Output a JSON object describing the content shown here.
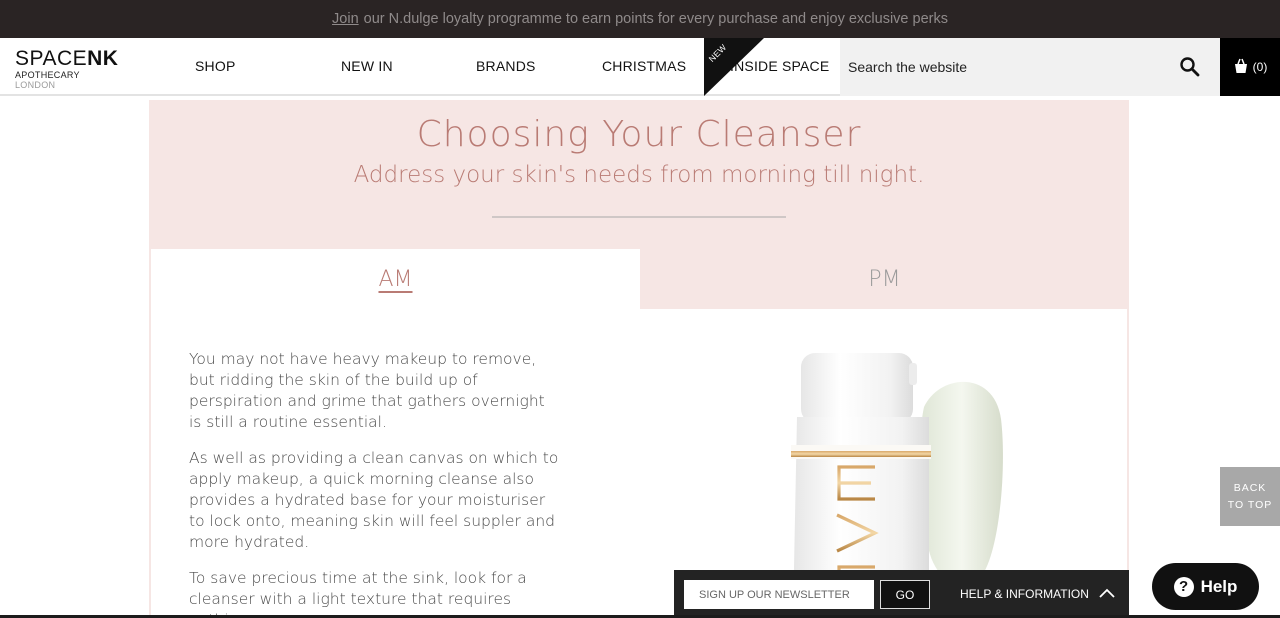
{
  "promo": {
    "link_text": "Join",
    "text": "our N.dulge loyalty programme to earn points for every purchase and enjoy exclusive perks"
  },
  "header": {
    "logo_main_a": "SPACE",
    "logo_main_b": "NK",
    "logo_sub_a": "APOTHECARY",
    "logo_sub_b": "LONDON",
    "nav": [
      "SHOP",
      "NEW IN",
      "BRANDS",
      "CHRISTMAS",
      "INSIDE SPACE"
    ],
    "new_badge": "NEW",
    "search_placeholder": "Search the website",
    "basket_count": "(0)"
  },
  "main": {
    "title": "Choosing Your Cleanser",
    "subtitle": "Address your skin's needs from morning till night.",
    "tabs": [
      {
        "label": "AM",
        "active": true
      },
      {
        "label": "PM",
        "active": false
      }
    ],
    "paragraphs": [
      "You may not have heavy makeup to remove, but ridding the skin of the build up of perspiration and grime that gathers overnight is still a routine essential.",
      "As well as providing a clean canvas on which to apply makeup, a quick morning cleanse also provides a hydrated base for your moisturiser to lock onto, meaning skin will feel suppler and more hydrated.",
      "To save precious time at the sink, look for a cleanser with a light texture that requires nothing"
    ],
    "product_brand_text": "EVE"
  },
  "footer": {
    "newsletter_placeholder": "SIGN UP OUR NEWSLETTER",
    "go_label": "GO",
    "help_info_label": "HELP & INFORMATION",
    "back_to_top_line1": "BACK",
    "back_to_top_line2": "TO TOP",
    "help_label": "Help"
  },
  "colors": {
    "accent": "#b97b74",
    "panel_bg": "#f6e6e4",
    "promo_bg": "#2a2424"
  }
}
